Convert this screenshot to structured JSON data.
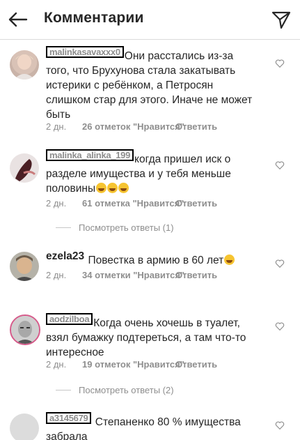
{
  "header": {
    "title": "Комментарии"
  },
  "comments": [
    {
      "username": "malinkasavaxxx0",
      "text": "Они расстались из-за того, что Брухунова стала закатывать истерики с ребёнком, а Петросян слишком стар для этого. Иначе не может быть",
      "time": "2 дн.",
      "likes": "26 отметок \"Нравится\"",
      "reply": "Ответить"
    },
    {
      "username": "malinka_alinka_199",
      "text": "когда пришел иск о разделе имущества и у тебя меньше половины",
      "emoji_count": 3,
      "time": "2 дн.",
      "likes": "61 отметка \"Нравится\"",
      "reply": "Ответить",
      "view_replies": "Посмотреть ответы (1)"
    },
    {
      "username": "ezela23",
      "text": "Повестка в армию в 60 лет",
      "emoji_count": 1,
      "time": "2 дн.",
      "likes": "34 отметки \"Нравится\"",
      "reply": "Ответить"
    },
    {
      "username": "aodzilboa",
      "text": "Когда очень хочешь в туалет, взял бумажку подтереться, а там что-то интересное",
      "time": "2 дн.",
      "likes": "19 отметок \"Нравится\"",
      "reply": "Ответить",
      "view_replies": "Посмотреть ответы (2)"
    },
    {
      "username": "a3145679",
      "text": "Степаненко 80 % имущества забрала"
    }
  ]
}
